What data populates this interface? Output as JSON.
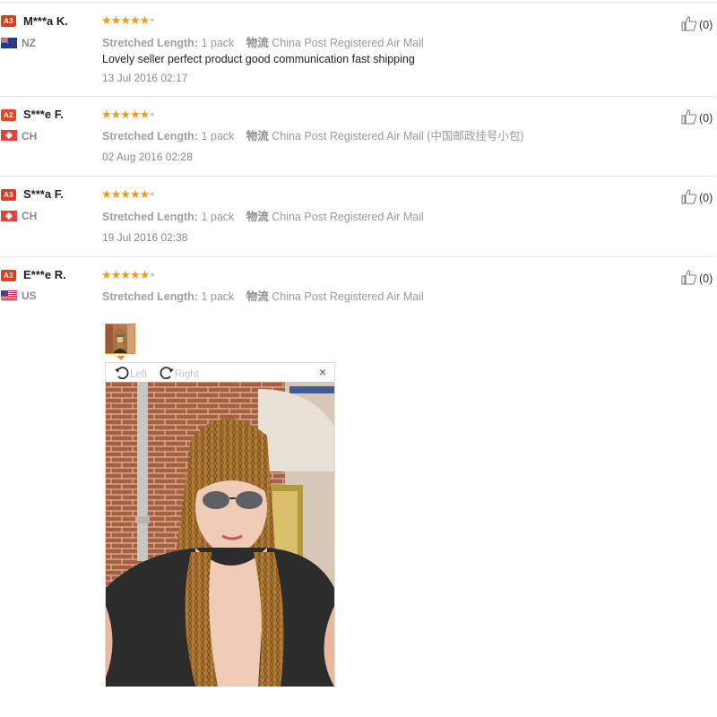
{
  "colors": {
    "badge": "#e33b1f",
    "star": "#f39a12",
    "thumb_border": "#f08a24"
  },
  "reviews": [
    {
      "level": "A3",
      "name": "M***a K.",
      "country": "NZ",
      "stars": "★★★★★",
      "length_label": "Stretched Length:",
      "length_value": "1 pack",
      "logistics_label": "物流",
      "logistics_value": "China Post Registered Air Mail",
      "text": "Lovely seller perfect product good communication fast shipping",
      "date": "13 Jul 2016 02:17",
      "helpful": "(0)"
    },
    {
      "level": "A2",
      "name": "S***e F.",
      "country": "CH",
      "stars": "★★★★★",
      "length_label": "Stretched Length:",
      "length_value": "1 pack",
      "logistics_label": "物流",
      "logistics_value": "China Post Registered Air Mail (中国邮政挂号小包)",
      "date": "02 Aug 2016 02:28",
      "helpful": "(0)"
    },
    {
      "level": "A3",
      "name": "S***a F.",
      "country": "CH",
      "stars": "★★★★★",
      "length_label": "Stretched Length:",
      "length_value": "1 pack",
      "logistics_label": "物流",
      "logistics_value": "China Post Registered Air Mail",
      "date": "19 Jul 2016 02:38",
      "helpful": "(0)"
    },
    {
      "level": "A3",
      "name": "E***e R.",
      "country": "US",
      "stars": "★★★★★",
      "length_label": "Stretched Length:",
      "length_value": "1 pack",
      "logistics_label": "物流",
      "logistics_value": "China Post Registered Air Mail",
      "helpful": "(0)"
    }
  ],
  "viewer": {
    "rotate_left": "Left",
    "rotate_right": "Right",
    "close": "×"
  },
  "icons": [
    "thumbs-up-icon",
    "rotate-left-icon",
    "rotate-right-icon",
    "close-icon",
    "nz-flag-icon",
    "ch-flag-icon",
    "us-flag-icon"
  ]
}
